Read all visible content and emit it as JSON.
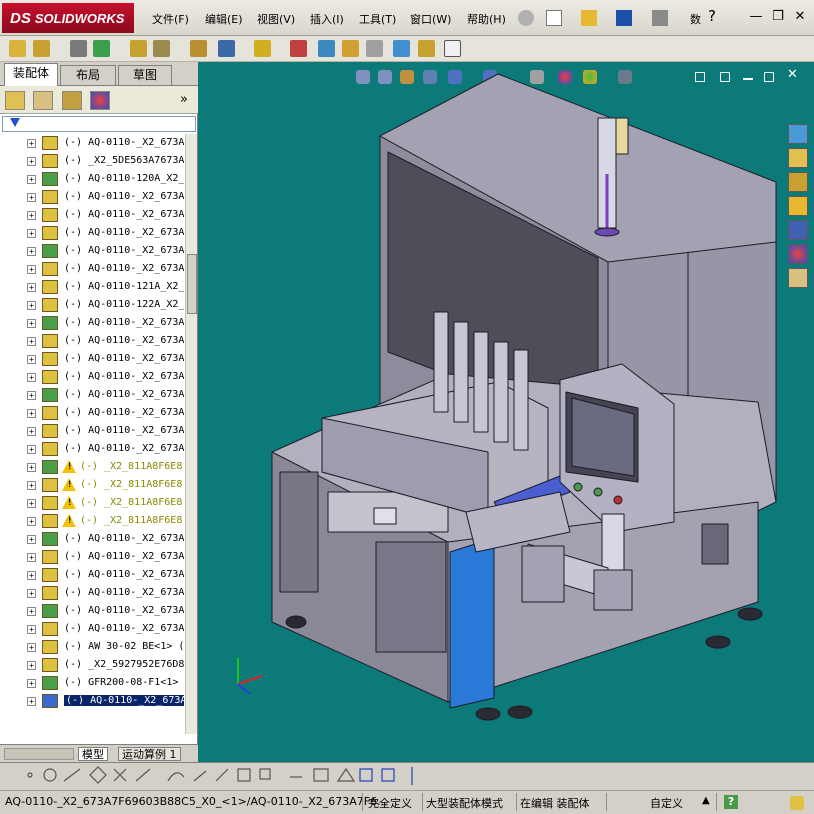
{
  "app": {
    "brand": "SOLIDWORKS",
    "brand_prefix": "DS"
  },
  "menu": [
    "文件(F)",
    "编辑(E)",
    "视图(V)",
    "插入(I)",
    "工具(T)",
    "窗口(W)",
    "帮助(H)"
  ],
  "menu_extra": "数",
  "help_glyph": "?",
  "window_controls": {
    "minimize": "—",
    "restore": "❐",
    "close": "✕"
  },
  "left_tabs": {
    "assembly": "装配体",
    "layout": "布局",
    "sketch": "草图"
  },
  "tree_expand": "»",
  "tree_rows": [
    {
      "label": "(-) AQ-0110-_X2_673A",
      "warn": false,
      "sel": false
    },
    {
      "label": "(-) _X2_5DE563A7673A",
      "warn": false,
      "sel": false
    },
    {
      "label": "(-) AQ-0110-120A_X2_",
      "warn": false,
      "sel": false
    },
    {
      "label": "(-) AQ-0110-_X2_673A",
      "warn": false,
      "sel": false
    },
    {
      "label": "(-) AQ-0110-_X2_673A",
      "warn": false,
      "sel": false
    },
    {
      "label": "(-) AQ-0110-_X2_673A",
      "warn": false,
      "sel": false
    },
    {
      "label": "(-) AQ-0110-_X2_673A",
      "warn": false,
      "sel": false
    },
    {
      "label": "(-) AQ-0110-_X2_673A",
      "warn": false,
      "sel": false
    },
    {
      "label": "(-) AQ-0110-121A_X2_",
      "warn": false,
      "sel": false
    },
    {
      "label": "(-) AQ-0110-122A_X2_",
      "warn": false,
      "sel": false
    },
    {
      "label": "(-) AQ-0110-_X2_673A",
      "warn": false,
      "sel": false
    },
    {
      "label": "(-) AQ-0110-_X2_673A",
      "warn": false,
      "sel": false
    },
    {
      "label": "(-) AQ-0110-_X2_673A",
      "warn": false,
      "sel": false
    },
    {
      "label": "(-) AQ-0110-_X2_673A",
      "warn": false,
      "sel": false
    },
    {
      "label": "(-) AQ-0110-_X2_673A",
      "warn": false,
      "sel": false
    },
    {
      "label": "(-) AQ-0110-_X2_673A",
      "warn": false,
      "sel": false
    },
    {
      "label": "(-) AQ-0110-_X2_673A",
      "warn": false,
      "sel": false
    },
    {
      "label": "(-) AQ-0110-_X2_673A",
      "warn": false,
      "sel": false
    },
    {
      "label": "(-) _X2_811A8F6E8",
      "warn": true,
      "sel": false
    },
    {
      "label": "(-) _X2_811A8F6E8",
      "warn": true,
      "sel": false
    },
    {
      "label": "(-) _X2_811A8F6E8",
      "warn": true,
      "sel": false
    },
    {
      "label": "(-) _X2_811A8F6E8",
      "warn": true,
      "sel": false
    },
    {
      "label": "(-) AQ-0110-_X2_673A",
      "warn": false,
      "sel": false
    },
    {
      "label": "(-) AQ-0110-_X2_673A",
      "warn": false,
      "sel": false
    },
    {
      "label": "(-) AQ-0110-_X2_673A",
      "warn": false,
      "sel": false
    },
    {
      "label": "(-) AQ-0110-_X2_673A",
      "warn": false,
      "sel": false
    },
    {
      "label": "(-) AQ-0110-_X2_673A",
      "warn": false,
      "sel": false
    },
    {
      "label": "(-) AQ-0110-_X2_673A",
      "warn": false,
      "sel": false
    },
    {
      "label": "(-) AW 30-02 BE<1> (",
      "warn": false,
      "sel": false
    },
    {
      "label": "(-) _X2_5927952E76D8",
      "warn": false,
      "sel": false
    },
    {
      "label": "(-) GFR200-08-F1<1>",
      "warn": false,
      "sel": false
    },
    {
      "label": "(-) AQ-0110-_X2_673A",
      "warn": false,
      "sel": true
    }
  ],
  "bottom_tabs": {
    "model": "模型",
    "motion": "运动算例 1"
  },
  "status": {
    "path": "AQ-0110-_X2_673A7F69603B88C5_X0_<1>/AQ-0110-_X2_673A7F6...",
    "fully_defined": "完全定义",
    "large_assembly": "大型装配体模式",
    "editing": "在编辑 装配体",
    "custom": "自定义",
    "help": "?"
  },
  "colors": {
    "viewport": "#0b7a79",
    "machine": "#9c9aa8",
    "panel_dark": "#555560",
    "blue_panel": "#2a78d8"
  }
}
